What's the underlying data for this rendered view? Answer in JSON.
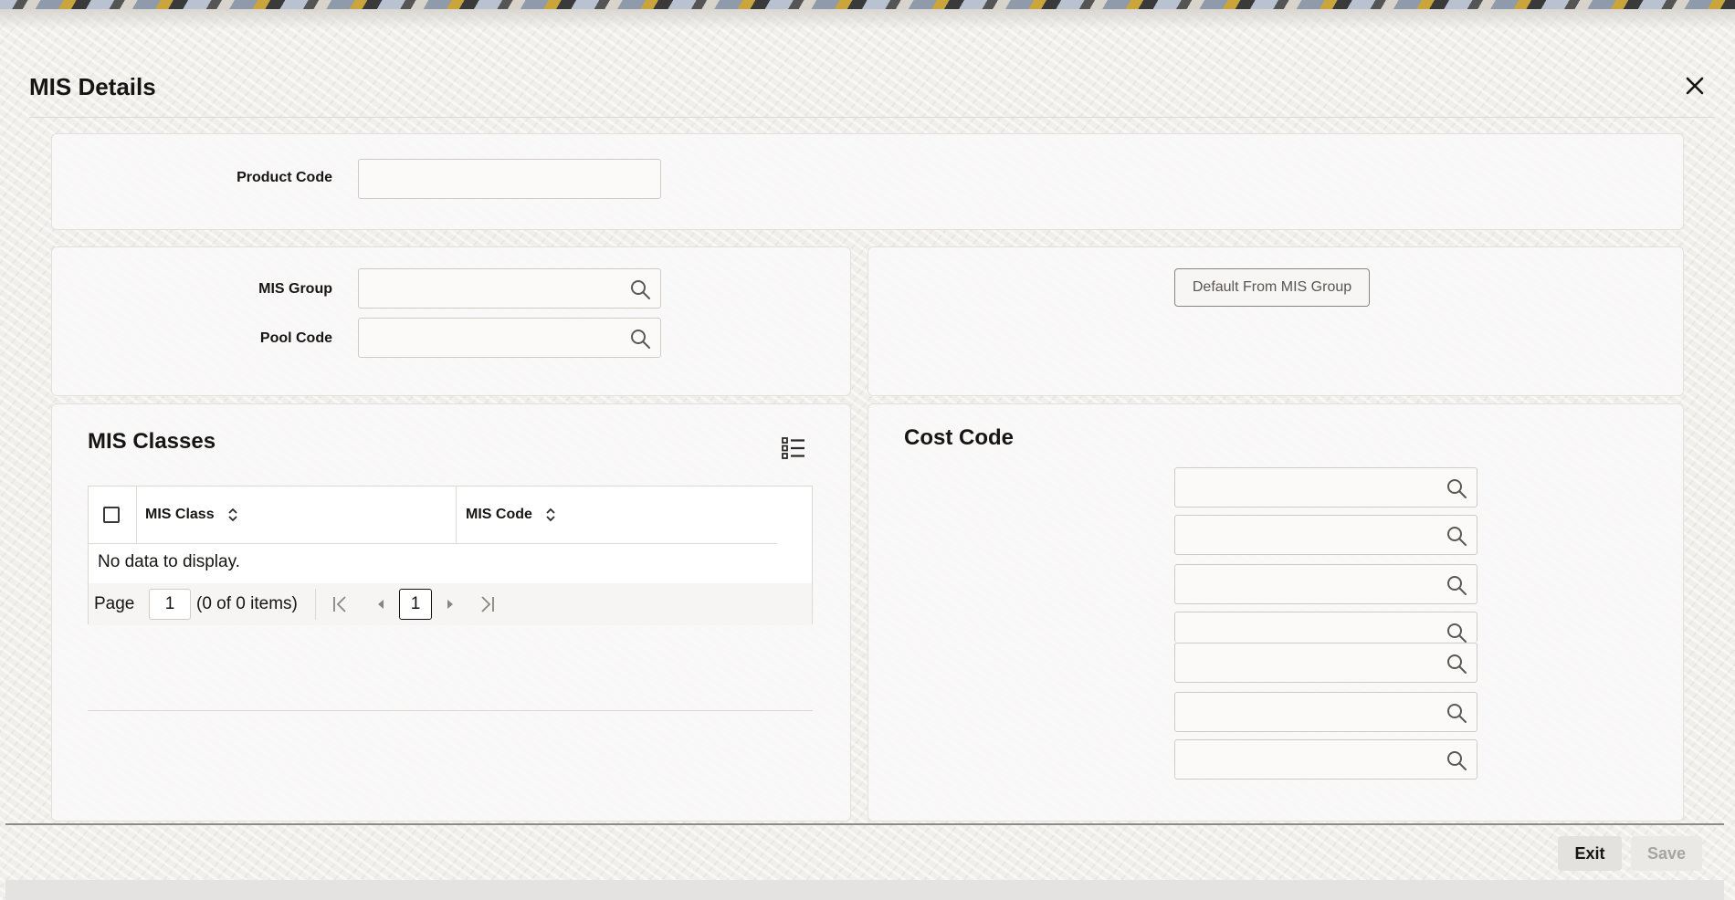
{
  "dialog": {
    "title": "MIS Details"
  },
  "form": {
    "product_code_label": "Product Code",
    "product_code_value": "",
    "mis_group_label": "MIS Group",
    "mis_group_value": "",
    "pool_code_label": "Pool Code",
    "pool_code_value": "",
    "default_button": "Default From MIS Group"
  },
  "mis_classes": {
    "title": "MIS Classes",
    "columns": [
      "MIS Class",
      "MIS Code"
    ],
    "rows": [],
    "empty_text": "No data to display.",
    "pager": {
      "page_label": "Page",
      "page_value": "1",
      "items_text": "(0 of 0 items)",
      "current_page": "1"
    }
  },
  "cost_code": {
    "title": "Cost Code",
    "fields": [
      "",
      "",
      "",
      "",
      "",
      "",
      ""
    ]
  },
  "footer": {
    "exit": "Exit",
    "save": "Save"
  },
  "icons": [
    "close-icon",
    "search-icon",
    "list-view-icon",
    "sort-icon",
    "first-page-icon",
    "previous-page-icon",
    "next-page-icon",
    "last-page-icon"
  ]
}
